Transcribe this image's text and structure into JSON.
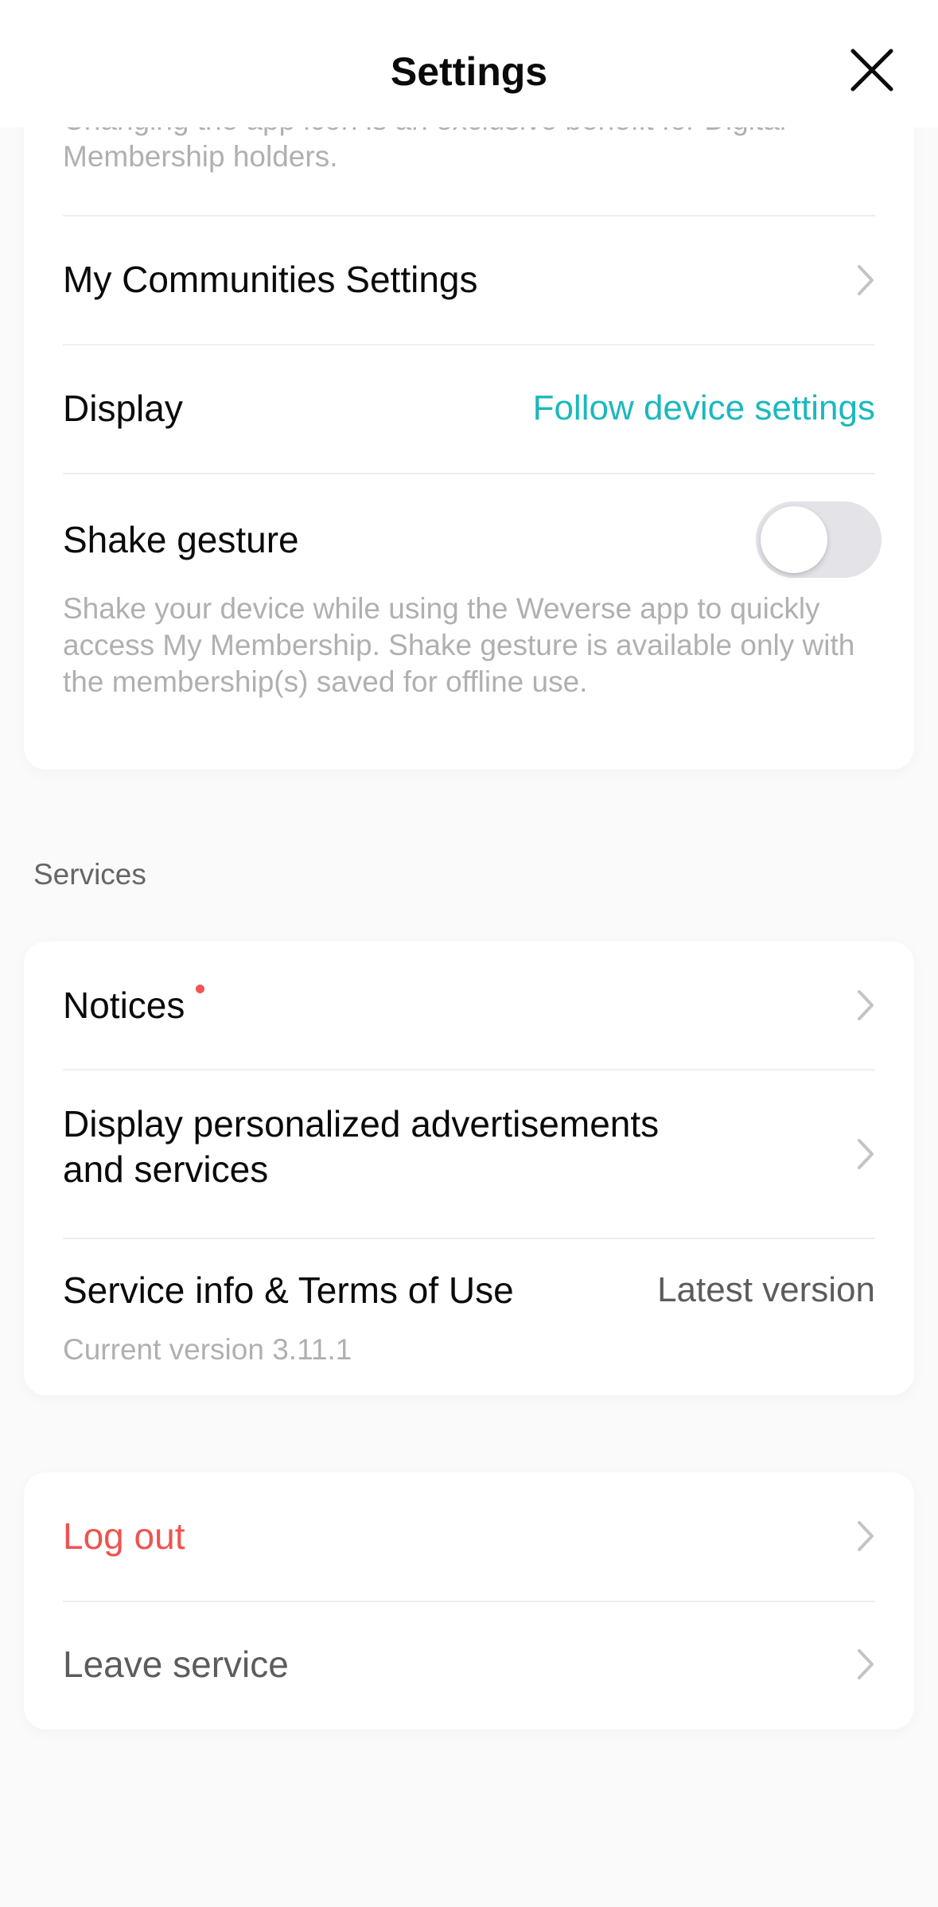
{
  "header": {
    "title": "Settings",
    "close_icon": "close-icon"
  },
  "app_icon_section": {
    "description": "Changing the app icon is an exclusive benefit for Digital Membership holders."
  },
  "general": {
    "communities": {
      "label": "My Communities Settings",
      "icon": "chevron-right-icon"
    },
    "display": {
      "label": "Display",
      "value": "Follow device settings",
      "value_color": "#1bb8bd"
    },
    "shake": {
      "label": "Shake gesture",
      "toggle_on": false,
      "description": "Shake your device while using the Weverse app to quickly access My Membership. Shake gesture is available only with the membership(s) saved for offline use."
    }
  },
  "services": {
    "section_title": "Services",
    "notices": {
      "label": "Notices",
      "has_badge": true,
      "badge_color": "#f25454",
      "icon": "chevron-right-icon"
    },
    "ads": {
      "label_line1": "Display personalized advertisements",
      "label_line2": "and services",
      "icon": "chevron-right-icon"
    },
    "terms": {
      "label": "Service info & Terms of Use",
      "value": "Latest version",
      "version": "Current version 3.11.1"
    }
  },
  "account": {
    "logout": {
      "label": "Log out",
      "color": "#ef5350",
      "icon": "chevron-right-icon"
    },
    "leave": {
      "label": "Leave service",
      "color": "#5c5c5c",
      "icon": "chevron-right-icon"
    }
  },
  "colors": {
    "accent": "#1bb8bd",
    "danger": "#ef5350",
    "background": "#fafafa",
    "card": "#ffffff"
  }
}
